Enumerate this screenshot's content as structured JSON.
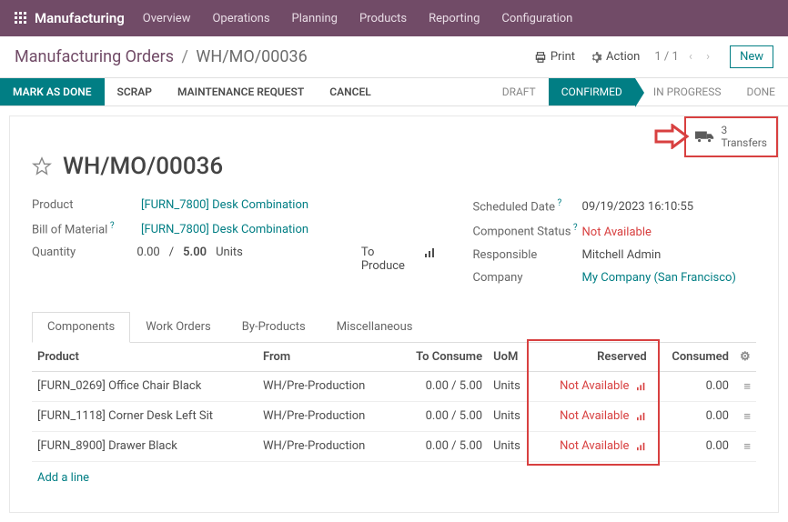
{
  "topbar": {
    "brand": "Manufacturing",
    "nav": [
      "Overview",
      "Operations",
      "Planning",
      "Products",
      "Reporting",
      "Configuration"
    ]
  },
  "breadcrumb": {
    "root": "Manufacturing Orders",
    "current": "WH/MO/00036"
  },
  "subbar": {
    "print": "Print",
    "action": "Action",
    "pager": "1 / 1",
    "new": "New"
  },
  "actions": {
    "mark_done": "MARK AS DONE",
    "scrap": "SCRAP",
    "maintenance": "MAINTENANCE REQUEST",
    "cancel": "CANCEL"
  },
  "statuses": {
    "draft": "DRAFT",
    "confirmed": "CONFIRMED",
    "in_progress": "IN PROGRESS",
    "done": "DONE"
  },
  "transfers": {
    "count": "3",
    "label": "Transfers"
  },
  "title": "WH/MO/00036",
  "left": {
    "product_label": "Product",
    "product": "[FURN_7800] Desk Combination",
    "bom_label": "Bill of Material",
    "bom": "[FURN_7800] Desk Combination",
    "qty_label": "Quantity",
    "qty_done": "0.00",
    "qty_sep": "/",
    "qty_total": "5.00",
    "uom": "Units",
    "toproduce": "To Produce"
  },
  "right": {
    "sched_label": "Scheduled Date",
    "sched": "09/19/2023 16:10:55",
    "comp_status_label": "Component Status",
    "comp_status": "Not Available",
    "resp_label": "Responsible",
    "resp": "Mitchell Admin",
    "company_label": "Company",
    "company": "My Company (San Francisco)"
  },
  "tabs": {
    "components": "Components",
    "work_orders": "Work Orders",
    "by_products": "By-Products",
    "misc": "Miscellaneous"
  },
  "grid": {
    "headers": {
      "product": "Product",
      "from": "From",
      "to_consume": "To Consume",
      "uom": "UoM",
      "reserved": "Reserved",
      "consumed": "Consumed"
    },
    "rows": [
      {
        "product": "[FURN_0269] Office Chair Black",
        "from": "WH/Pre-Production",
        "consume": "0.00 /  5.00",
        "uom": "Units",
        "reserved": "Not Available",
        "consumed": "0.00"
      },
      {
        "product": "[FURN_1118] Corner Desk Left Sit",
        "from": "WH/Pre-Production",
        "consume": "0.00 /  5.00",
        "uom": "Units",
        "reserved": "Not Available",
        "consumed": "0.00"
      },
      {
        "product": "[FURN_8900] Drawer Black",
        "from": "WH/Pre-Production",
        "consume": "0.00 /  5.00",
        "uom": "Units",
        "reserved": "Not Available",
        "consumed": "0.00"
      }
    ],
    "addline": "Add a line"
  }
}
